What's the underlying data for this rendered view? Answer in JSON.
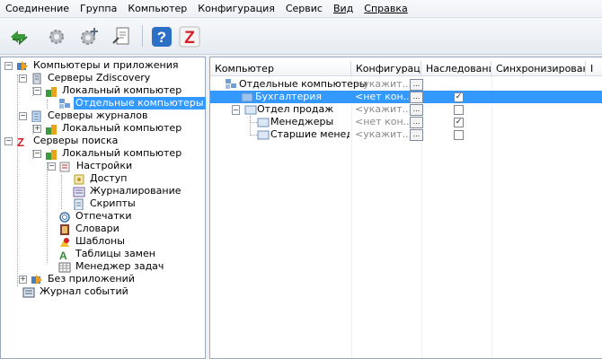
{
  "menu": {
    "items": [
      {
        "label": "Соединение"
      },
      {
        "label": "Группа"
      },
      {
        "label": "Компьютер"
      },
      {
        "label": "Конфигурация"
      },
      {
        "label": "Сервис"
      },
      {
        "label": "Вид"
      },
      {
        "label": "Справка"
      }
    ]
  },
  "toolbar": {
    "buttons": [
      {
        "icon": "refresh-icon"
      },
      {
        "icon": "gear-icon"
      },
      {
        "icon": "add-gear-icon"
      },
      {
        "icon": "document-icon"
      },
      {
        "icon": "help-icon"
      },
      {
        "icon": "zdiscovery-icon"
      }
    ]
  },
  "tree": {
    "nodes": [
      {
        "label": "Компьютеры и приложения",
        "icon": "computer-apps-icon"
      },
      {
        "label": "Серверы Zdiscovery",
        "icon": "server-icon"
      },
      {
        "label": "Локальный компьютер",
        "icon": "local-computer-icon"
      },
      {
        "label": "Отдельные компьютеры",
        "icon": "computers-group-icon"
      },
      {
        "label": "Серверы журналов",
        "icon": "journal-server-icon"
      },
      {
        "label": "Локальный компьютер",
        "icon": "local-computer-icon"
      },
      {
        "label": "Серверы поиска",
        "icon": "search-server-icon"
      },
      {
        "label": "Локальный компьютер",
        "icon": "local-computer-icon"
      },
      {
        "label": "Настройки",
        "icon": "settings-icon"
      },
      {
        "label": "Доступ",
        "icon": "access-icon"
      },
      {
        "label": "Журналирование",
        "icon": "logging-icon"
      },
      {
        "label": "Скрипты",
        "icon": "scripts-icon"
      },
      {
        "label": "Отпечатки",
        "icon": "fingerprint-icon"
      },
      {
        "label": "Словари",
        "icon": "dictionary-icon"
      },
      {
        "label": "Шаблоны",
        "icon": "templates-icon"
      },
      {
        "label": "Таблицы замен",
        "icon": "replace-table-icon"
      },
      {
        "label": "Менеджер задач",
        "icon": "task-manager-icon"
      },
      {
        "label": "Без приложений",
        "icon": "no-apps-icon"
      },
      {
        "label": "Журнал событий",
        "icon": "event-log-icon"
      }
    ]
  },
  "grid": {
    "columns": [
      {
        "label": "Компьютер"
      },
      {
        "label": "Конфигурация"
      },
      {
        "label": "Наследование"
      },
      {
        "label": "Синхронизировано"
      },
      {
        "label": "I"
      }
    ],
    "rows": [
      {
        "name": "Отдельные компьютеры",
        "config": "<укажит...",
        "inherit": null
      },
      {
        "name": "Бухгалтерия",
        "config": "<нет кон...",
        "inherit": true
      },
      {
        "name": "Отдел продаж",
        "config": "<укажит...",
        "inherit": false
      },
      {
        "name": "Менеджеры",
        "config": "<нет кон...",
        "inherit": true
      },
      {
        "name": "Старшие менедж...",
        "config": "<укажит...",
        "inherit": false
      }
    ],
    "ellipsis_label": "..."
  }
}
